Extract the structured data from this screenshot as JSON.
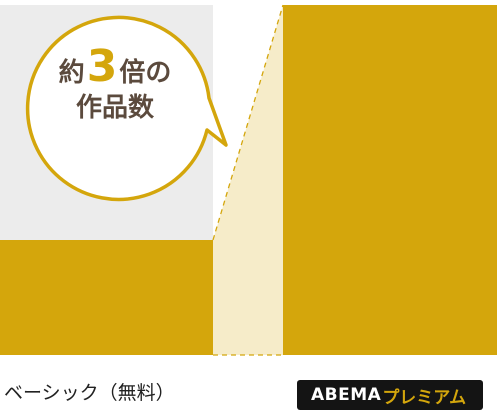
{
  "bubble": {
    "prefix": "約",
    "number": "3",
    "suffix": "倍の",
    "line2": "作品数"
  },
  "basic_label": "ベーシック（無料）",
  "premium_badge": {
    "main": "ABEMA",
    "sub": "プレミアム"
  },
  "colors": {
    "gold": "#d4a60c",
    "light_gray": "#ececec",
    "cream": "#f6ecc9",
    "bubble_text": "#5b4a3d",
    "badge_bg": "#141414"
  }
}
